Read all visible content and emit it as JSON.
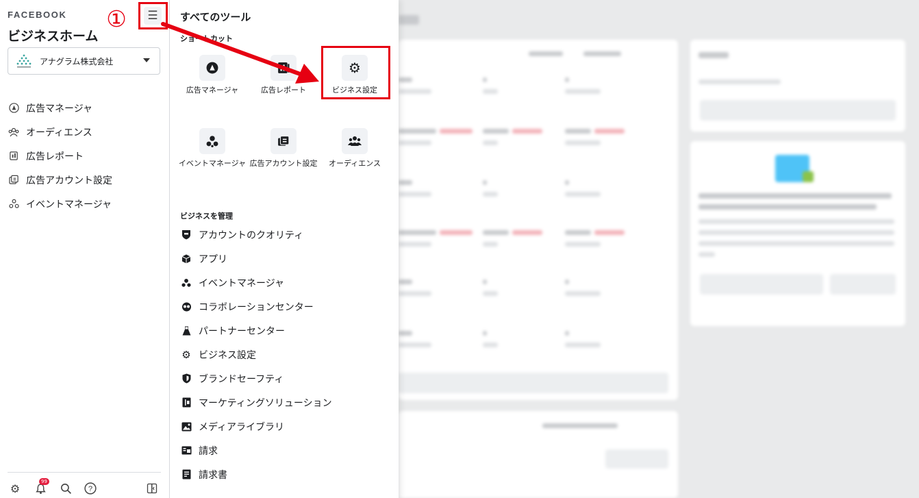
{
  "sidebar": {
    "brand": "FACEBOOK",
    "title": "ビジネスホーム",
    "menu_icon": "hamburger-icon",
    "account": {
      "name": "アナグラム株式会社"
    },
    "nav": [
      {
        "label": "広告マネージャ",
        "icon": "ads-manager-icon"
      },
      {
        "label": "オーディエンス",
        "icon": "audience-icon"
      },
      {
        "label": "広告レポート",
        "icon": "ads-report-icon"
      },
      {
        "label": "広告アカウント設定",
        "icon": "ad-account-settings-icon"
      },
      {
        "label": "イベントマネージャ",
        "icon": "events-manager-icon"
      }
    ],
    "bottom": {
      "notification_count": "99"
    }
  },
  "tools": {
    "title": "すべてのツール",
    "shortcuts_heading": "ショートカット",
    "shortcuts": [
      {
        "label": "広告マネージャ",
        "icon": "ads-manager-icon"
      },
      {
        "label": "広告レポート",
        "icon": "ads-report-icon"
      },
      {
        "label": "ビジネス設定",
        "icon": "gear-icon"
      },
      {
        "label": "イベントマネージャ",
        "icon": "events-manager-icon"
      },
      {
        "label": "広告アカウント設定",
        "icon": "ad-account-settings-icon"
      },
      {
        "label": "オーディエンス",
        "icon": "audience-icon"
      }
    ],
    "manage_heading": "ビジネスを管理",
    "manage": [
      {
        "label": "アカウントのクオリティ",
        "icon": "shield-check-icon"
      },
      {
        "label": "アプリ",
        "icon": "cube-icon"
      },
      {
        "label": "イベントマネージャ",
        "icon": "events-manager-icon"
      },
      {
        "label": "コラボレーションセンター",
        "icon": "handshake-icon"
      },
      {
        "label": "パートナーセンター",
        "icon": "flask-icon"
      },
      {
        "label": "ビジネス設定",
        "icon": "gear-icon"
      },
      {
        "label": "ブランドセーフティ",
        "icon": "shield-icon"
      },
      {
        "label": "マーケティングソリューション",
        "icon": "book-icon"
      },
      {
        "label": "メディアライブラリ",
        "icon": "image-icon"
      },
      {
        "label": "請求",
        "icon": "billing-icon"
      },
      {
        "label": "請求書",
        "icon": "invoice-icon"
      }
    ]
  },
  "annotation": {
    "step_marker": "①",
    "color": "#e60012"
  },
  "colors": {
    "accent": "#e60012",
    "panel_bg": "#ffffff",
    "page_bg": "#e9eaeb"
  }
}
